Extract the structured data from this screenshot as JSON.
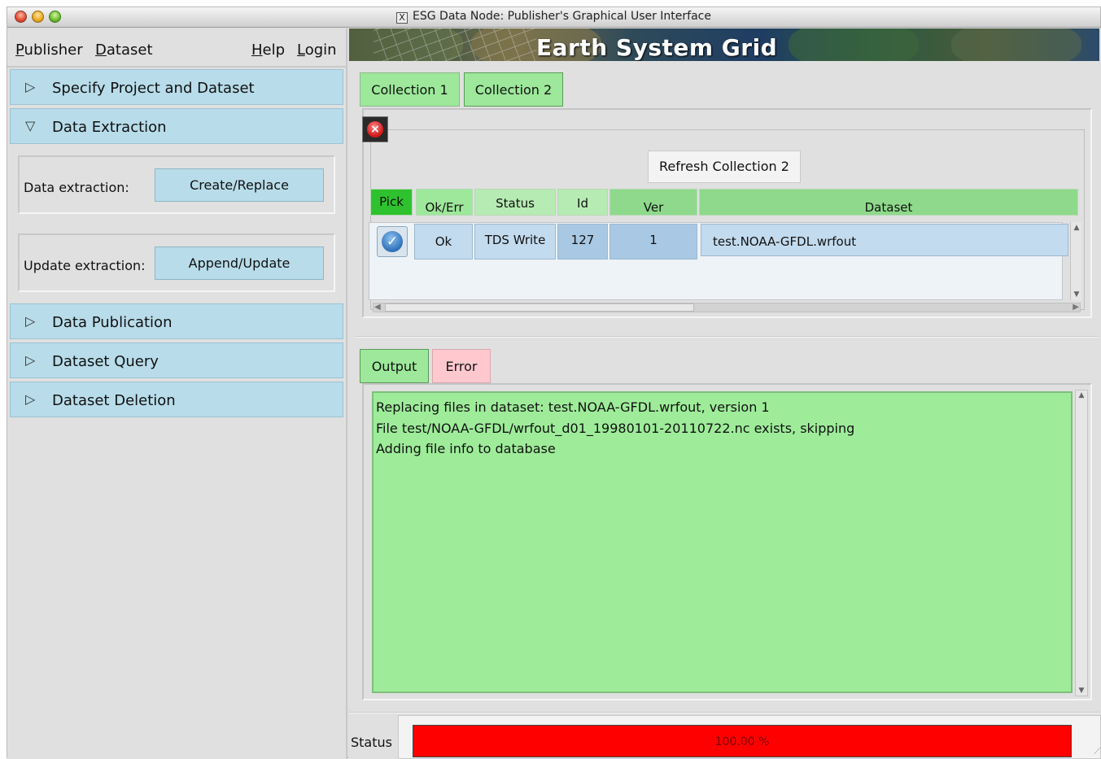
{
  "window": {
    "title_glyph": "X",
    "title": "ESG Data Node: Publisher's Graphical User Interface"
  },
  "menubar": {
    "publisher": "Publisher",
    "dataset": "Dataset",
    "help": "Help",
    "login": "Login"
  },
  "sidebar": {
    "sections": [
      {
        "label": "Specify Project and Dataset",
        "expanded": false
      },
      {
        "label": "Data Extraction",
        "expanded": true
      },
      {
        "label": "Data Publication",
        "expanded": false
      },
      {
        "label": "Dataset Query",
        "expanded": false
      },
      {
        "label": "Dataset Deletion",
        "expanded": false
      }
    ],
    "extraction": {
      "data_label": "Data extraction:",
      "data_button": "Create/Replace",
      "update_label": "Update extraction:",
      "update_button": "Append/Update"
    }
  },
  "banner": {
    "title": "Earth System Grid"
  },
  "collection_tabs": [
    {
      "label": "Collection 1",
      "active": false
    },
    {
      "label": "Collection 2",
      "active": true
    }
  ],
  "collection": {
    "refresh_button": "Refresh Collection 2",
    "columns": [
      "Pick",
      "Ok/Err",
      "Status",
      "Id",
      "Ver",
      "Dataset"
    ],
    "rows": [
      {
        "pick": "checked",
        "ok_err": "Ok",
        "status": "TDS Write",
        "id": "127",
        "ver": "1",
        "dataset": "test.NOAA-GFDL.wrfout"
      }
    ]
  },
  "output_tabs": [
    {
      "label": "Output",
      "active": true
    },
    {
      "label": "Error",
      "active": false
    }
  ],
  "output": {
    "lines": [
      "Replacing files in dataset: test.NOAA-GFDL.wrfout, version 1",
      "File test/NOAA-GFDL/wrfout_d01_19980101-20110722.nc exists, skipping",
      "Adding file info to database"
    ]
  },
  "status": {
    "label": "Status",
    "progress_text": "100.00 %",
    "progress_fraction": 1.0,
    "progress_color": "#ff0000"
  },
  "colors": {
    "section_blue": "#b8dcea",
    "tab_green": "#9de89a",
    "tab_pink": "#ffc8cf",
    "output_green": "#9eec9a"
  },
  "icons": {
    "close": "close-icon",
    "check": "check-circle-icon",
    "expand": "triangle-right-icon",
    "collapse": "triangle-down-icon"
  }
}
